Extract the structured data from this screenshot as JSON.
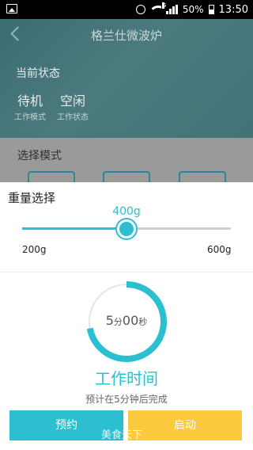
{
  "status_bar": {
    "icons": [
      "image-icon",
      "alarm-icon",
      "wifi-icon",
      "signal-icon",
      "battery-icon"
    ],
    "network": "G",
    "battery": "50%",
    "time": "13:50"
  },
  "app": {
    "title": "格兰仕微波炉",
    "current_status_title": "当前状态",
    "states": [
      {
        "value": "待机",
        "label": "工作模式"
      },
      {
        "value": "空闲",
        "label": "工作状态"
      }
    ],
    "mode_section_title": "选择模式"
  },
  "weight": {
    "title": "重量选择",
    "value": "400g",
    "min_label": "200g",
    "max_label": "600g",
    "min": 200,
    "max": 600,
    "current": 400
  },
  "timer": {
    "minutes": "5",
    "minute_unit": "分",
    "seconds": "00",
    "second_unit": "秒",
    "progress": 0.72,
    "label": "工作时间",
    "eta": "预计在5分钟后完成"
  },
  "buttons": {
    "book": "预约",
    "start": "启动"
  },
  "watermark": "美食天下",
  "colors": {
    "accent": "#2bbfd0",
    "start_button": "#fcc93f"
  }
}
